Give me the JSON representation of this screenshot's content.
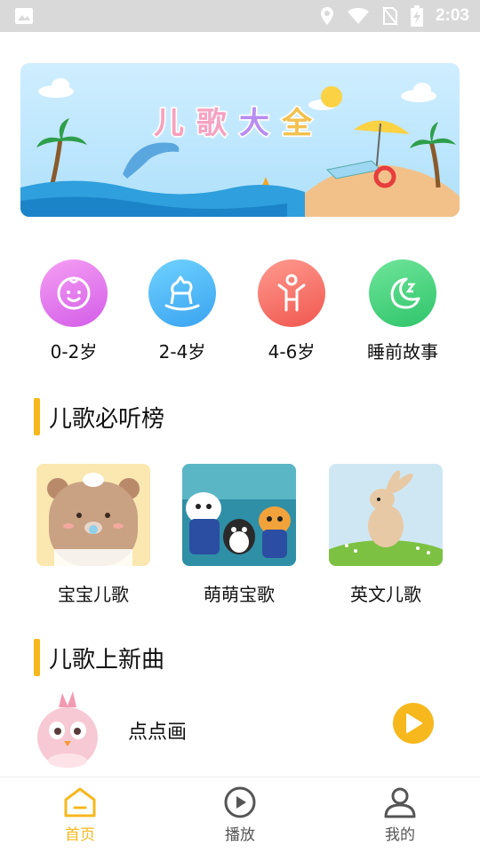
{
  "status_bar": {
    "time": "2:03",
    "icons": [
      "image-icon",
      "location-icon",
      "wifi-icon",
      "no-sim-icon",
      "battery-charging-icon"
    ]
  },
  "banner": {
    "title_chars": [
      "儿",
      "歌",
      "大",
      "全"
    ],
    "title_colors": [
      "#f7a1bd",
      "#f5a3c2",
      "#b78cf2",
      "#f4c04f"
    ]
  },
  "categories": [
    {
      "label": "0-2岁",
      "icon": "baby-face-icon",
      "color_from": "#f59ff3",
      "color_to": "#d35ce8"
    },
    {
      "label": "2-4岁",
      "icon": "rocking-horse-icon",
      "color_from": "#6fd2ff",
      "color_to": "#3aa3f0"
    },
    {
      "label": "4-6岁",
      "icon": "child-icon",
      "color_from": "#ff9a8f",
      "color_to": "#f0574f"
    },
    {
      "label": "睡前故事",
      "icon": "moon-sleep-icon",
      "color_from": "#6fe59b",
      "color_to": "#2fc46a"
    }
  ],
  "sections": {
    "ranking_title": "儿歌必听榜",
    "new_songs_title": "儿歌上新曲"
  },
  "ranking": [
    {
      "label": "宝宝儿歌",
      "image": "bear-illustration"
    },
    {
      "label": "萌萌宝歌",
      "image": "cartoon-characters-illustration"
    },
    {
      "label": "英文儿歌",
      "image": "bunny-illustration"
    }
  ],
  "new_songs": [
    {
      "title": "点点画",
      "image": "pink-bird-illustration"
    }
  ],
  "bottom_nav": [
    {
      "label": "首页",
      "icon": "home-icon",
      "active": true
    },
    {
      "label": "播放",
      "icon": "play-circle-icon",
      "active": false
    },
    {
      "label": "我的",
      "icon": "user-icon",
      "active": false
    }
  ],
  "colors": {
    "accent": "#f6b81c",
    "inactive": "#555555",
    "status_bar": "#d9d9d9"
  }
}
